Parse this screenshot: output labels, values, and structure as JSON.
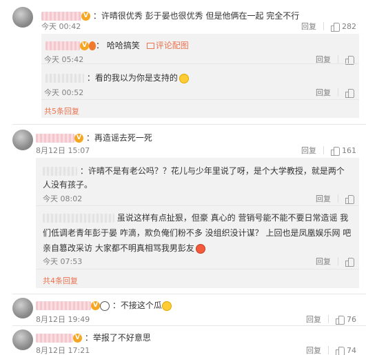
{
  "comments": [
    {
      "text": "：许晴很优秀 彭于晏也很优秀 但是他俩在一起 完全不行",
      "time": "今天 00:42",
      "reply_label": "回复",
      "likes": "282",
      "replies": [
        {
          "text": "哈哈搞笑",
          "link": "评论配图",
          "time": "今天 05:42",
          "reply_label": "回复"
        },
        {
          "text": "：看的我以为你是支持的",
          "time": "今天 00:52",
          "reply_label": "回复"
        }
      ],
      "more": "共5条回复"
    },
    {
      "text": "：再造谣去死一死",
      "time": "8月12日 15:07",
      "reply_label": "回复",
      "likes": "161",
      "replies": [
        {
          "text": "：许晴不是有老公吗？？花儿与少年里说了呀，是个大学教授，就是两个人没有孩子。",
          "time": "今天 08:02",
          "reply_label": "回复"
        },
        {
          "text": "虽说这样有点扯狠，但豪 真心的   营销号能不能不要日常造谣 我们低调老青年彭于晏   咋滴，欺负俺们粉不多 没组织没计谋？  上回也是凤凰娱乐网 吧 亲自篡改采访 大家都不明真相骂我男彭友",
          "time": "今天 07:53",
          "reply_label": "回复"
        }
      ],
      "more": "共4条回复"
    },
    {
      "text": "：不接这个瓜",
      "time": "8月12日 19:49",
      "reply_label": "回复",
      "likes": "76"
    },
    {
      "text": "：举报了不好意思",
      "time": "8月12日 17:21",
      "reply_label": "回复",
      "likes": "74"
    }
  ]
}
